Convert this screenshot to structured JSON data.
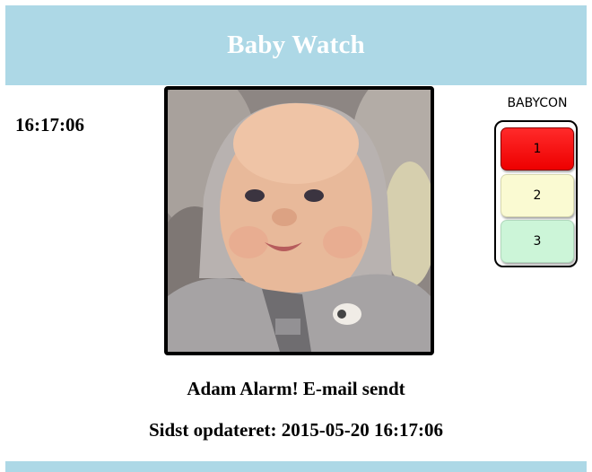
{
  "header": {
    "title": "Baby Watch"
  },
  "clock": {
    "time": "16:17:06"
  },
  "photo": {
    "subject": "baby-photo"
  },
  "babycon": {
    "label": "BABYCON",
    "levels": [
      {
        "label": "1",
        "color": "#ff0000"
      },
      {
        "label": "2",
        "color": "#fafad2"
      },
      {
        "label": "3",
        "color": "#ccf5d8"
      }
    ]
  },
  "status": {
    "message": "Adam Alarm! E-mail sendt"
  },
  "updated": {
    "label": "Sidst opdateret:",
    "timestamp": "2015-05-20 16:17:06"
  },
  "colors": {
    "header_bg": "#add8e6",
    "header_text": "#ffffff"
  }
}
